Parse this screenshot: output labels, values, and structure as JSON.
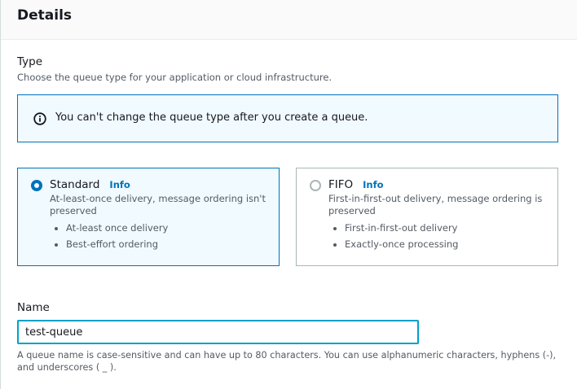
{
  "panel": {
    "title": "Details"
  },
  "type_field": {
    "label": "Type",
    "description": "Choose the queue type for your application or cloud infrastructure."
  },
  "alert": {
    "icon": "info-circle-icon",
    "text": "You can't change the queue type after you create a queue."
  },
  "queue_types": [
    {
      "title": "Standard",
      "info": "Info",
      "selected": true,
      "description": "At-least-once delivery, message ordering isn't preserved",
      "features": [
        "At-least once delivery",
        "Best-effort ordering"
      ]
    },
    {
      "title": "FIFO",
      "info": "Info",
      "selected": false,
      "description": "First-in-first-out delivery, message ordering is preserved",
      "features": [
        "First-in-first-out delivery",
        "Exactly-once processing"
      ]
    }
  ],
  "name_field": {
    "label": "Name",
    "value": "test-queue",
    "constraint": "A queue name is case-sensitive and can have up to 80 characters. You can use alphanumeric characters, hyphens (-), and underscores ( _ )."
  },
  "colors": {
    "accent": "#0073bb",
    "selected_bg": "#f1faff",
    "focus_border": "#00a1c9"
  }
}
